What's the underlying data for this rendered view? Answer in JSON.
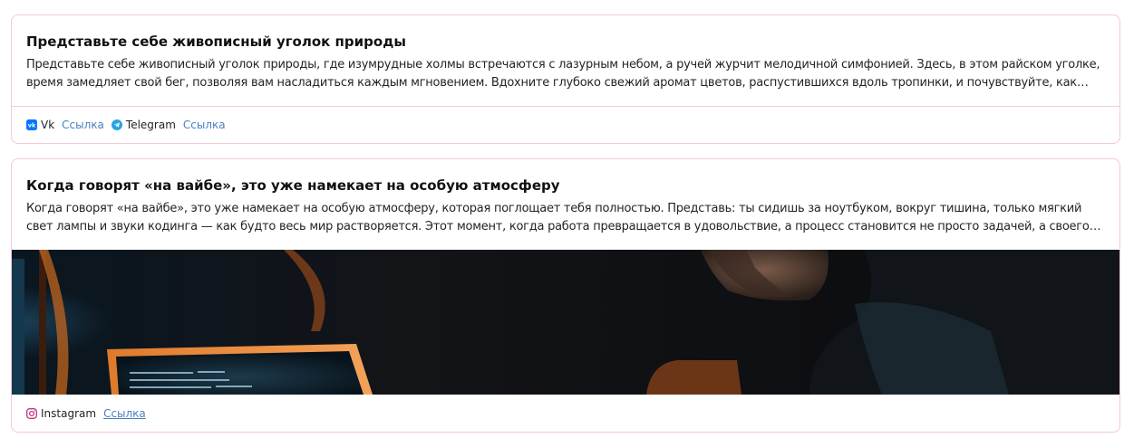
{
  "posts": [
    {
      "title": "Представьте себе живописный уголок природы",
      "text": "Представьте себе живописный уголок природы, где изумрудные холмы встречаются с лазурным небом, а ручей журчит мелодичной симфонией. Здесь, в этом райском уголке, время замедляет свой бег, позволяя вам насладиться каждым мгновением. Вдохните глубоко свежий аромат цветов, распустившихся вдоль тропинки, и почувствуйте, как стресс и тревоги...",
      "links": [
        {
          "icon": "vk-icon",
          "name": "Vk",
          "link_label": "Ссылка"
        },
        {
          "icon": "telegram-icon",
          "name": "Telegram",
          "link_label": "Ссылка"
        }
      ]
    },
    {
      "title": "Когда говорят «на вайбе», это уже намекает на особую атмосферу",
      "text": "Когда говорят «на вайбе», это уже намекает на особую атмосферу, которая поглощает тебя полностью. Представь: ты сидишь за ноутбуком, вокруг тишина, только мягкий свет лампы и звуки кодинга — как будто весь мир растворяется. Этот момент, когда работа превращается в удовольствие, а процесс становится не просто задачей, а своего рода...",
      "image_icon": "photo-coder-at-laptop",
      "links": [
        {
          "icon": "instagram-icon",
          "name": "Instagram",
          "link_label": "Ссылка"
        }
      ]
    }
  ],
  "colors": {
    "card_border": "#f2c9d8",
    "link": "#4a7fc1",
    "vk": "#0077ff",
    "telegram": "#2aa3e0",
    "instagram": "#c13584"
  }
}
